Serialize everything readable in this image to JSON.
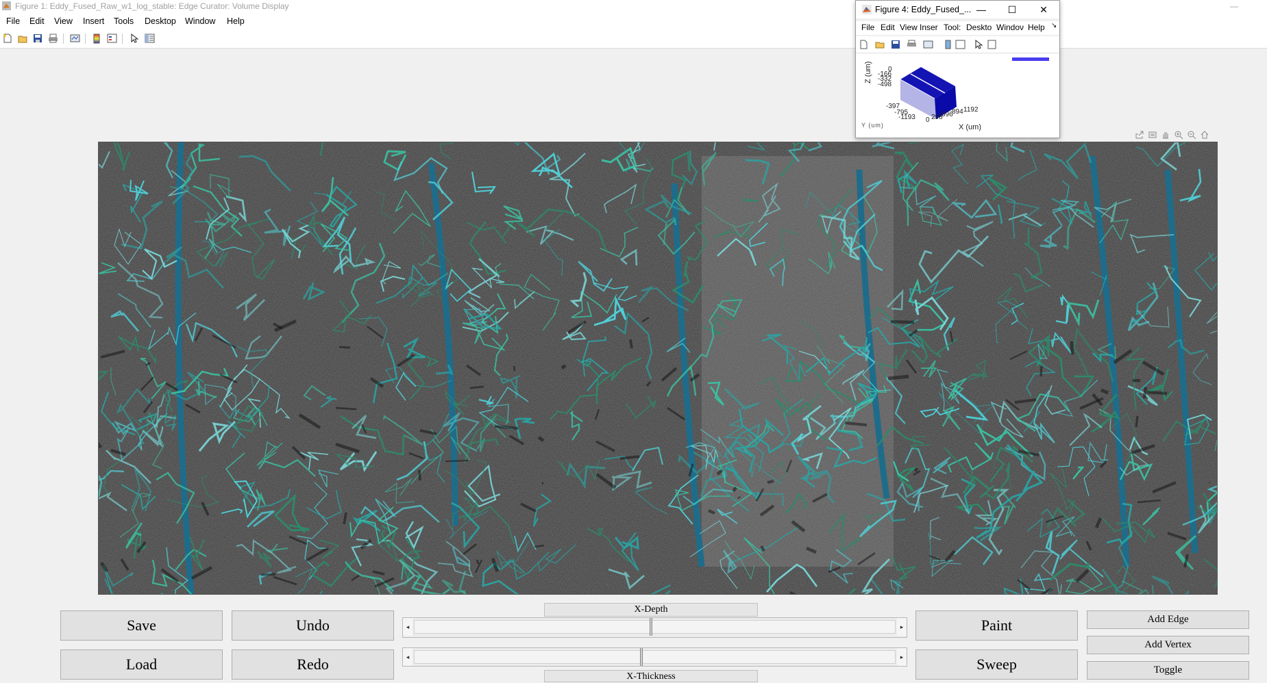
{
  "window": {
    "title": "Figure 1: Eddy_Fused_Raw_w1_log_stable: Edge Curator: Volume Display",
    "minimize": "—"
  },
  "menubar": {
    "items": [
      "File",
      "Edit",
      "View",
      "Insert",
      "Tools",
      "Desktop",
      "Window",
      "Help"
    ]
  },
  "toolbar": {
    "icons": [
      "new-figure-icon",
      "open-icon",
      "save-icon",
      "print-icon",
      "link-plot-icon",
      "colorbar-icon",
      "legend-icon",
      "pointer-icon",
      "property-inspector-icon"
    ]
  },
  "axes_toolbar": {
    "icons": [
      "export-icon",
      "brush-icon",
      "pan-icon",
      "zoom-in-icon",
      "zoom-out-icon",
      "home-icon"
    ]
  },
  "controls": {
    "save": "Save",
    "undo": "Undo",
    "load": "Load",
    "redo": "Redo",
    "paint": "Paint",
    "sweep": "Sweep",
    "add_edge": "Add Edge",
    "add_vertex": "Add Vertex",
    "toggle": "Toggle",
    "depth_label": "X-Depth",
    "thickness_label": "X-Thickness",
    "depth_slider_value": 0.49,
    "thickness_slider_value": 0.47
  },
  "figure4": {
    "title": "Figure 4: Eddy_Fused_...",
    "menu": [
      "File",
      "Edit",
      "View",
      "Inser",
      "Tool:",
      "Deskto",
      "Windoν",
      "Help"
    ],
    "z_axis_label": "Z (um)",
    "x_axis_label": "X (um)",
    "y_axis_label": "Y (um)",
    "z_ticks": [
      "0",
      "-166",
      "-332",
      "-498"
    ],
    "y_ticks": [
      "-397",
      "-795",
      "-1193"
    ],
    "x_ticks": [
      "0",
      "298",
      "596",
      "894",
      "1192"
    ],
    "colors": {
      "box_front": "#0a0aa8",
      "box_side": "#b4b4e6",
      "legend": "#4a3cf0"
    }
  },
  "colors": {
    "accent_vessel": "#4fd0d8",
    "vessel_dark": "#1f6c8a",
    "background_tissue": "#3b3b3b"
  }
}
